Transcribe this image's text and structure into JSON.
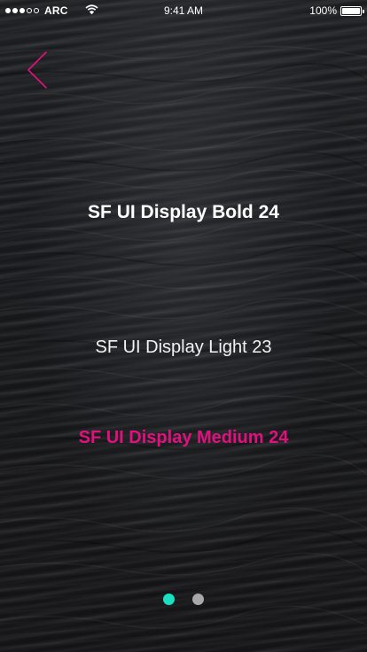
{
  "status_bar": {
    "signal_full": 3,
    "signal_empty": 2,
    "carrier": "ARC",
    "time": "9:41 AM",
    "battery_text": "100%",
    "battery_level": 1.0
  },
  "back": {
    "icon": "chevron-left-icon",
    "color": "#e0117e"
  },
  "labels": {
    "bold": "SF UI Display Bold 24",
    "light": "SF UI Display Light 23",
    "medium": "SF UI Display Medium 24"
  },
  "colors": {
    "accent": "#e0117e",
    "active_dot": "#19e0c2",
    "inactive_dot": "#a8a8a8"
  },
  "pager": {
    "count": 2,
    "active_index": 0
  }
}
